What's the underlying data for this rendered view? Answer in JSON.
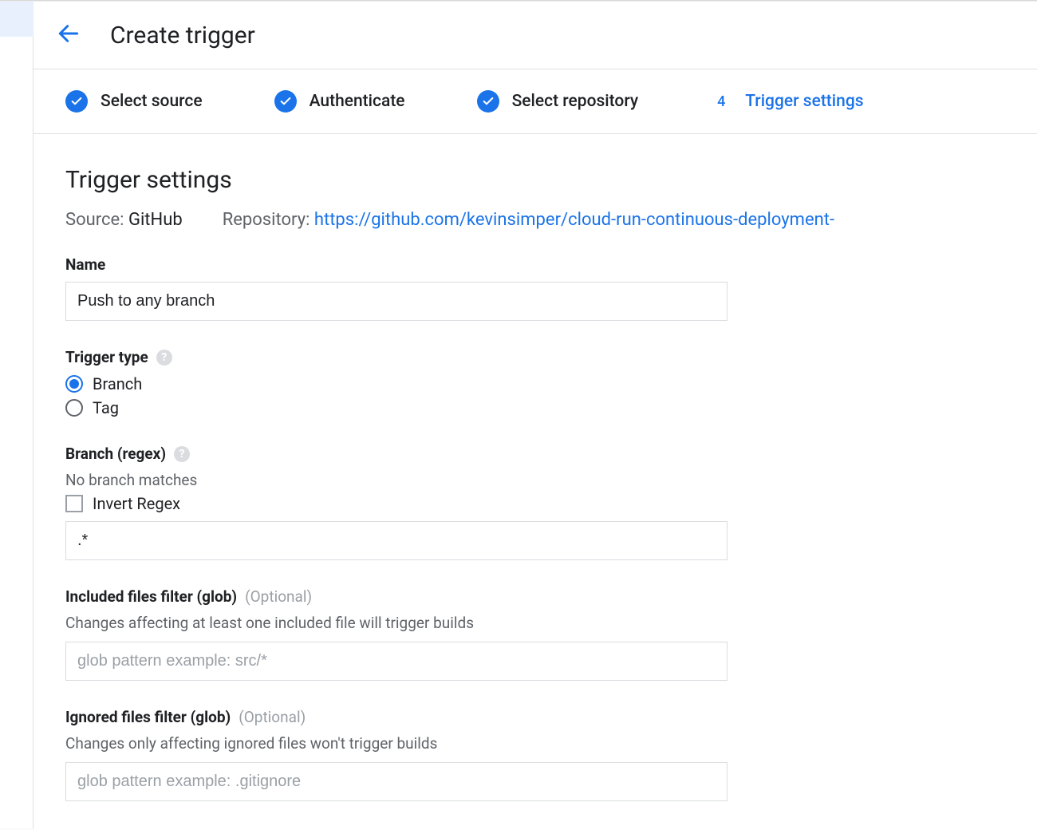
{
  "page_title": "Create trigger",
  "stepper": [
    {
      "label": "Select source",
      "done": true
    },
    {
      "label": "Authenticate",
      "done": true
    },
    {
      "label": "Select repository",
      "done": true
    },
    {
      "number": "4",
      "label": "Trigger settings",
      "current": true
    }
  ],
  "section_title": "Trigger settings",
  "meta": {
    "source_label": "Source:",
    "source_value": "GitHub",
    "repo_label": "Repository:",
    "repo_url": "https://github.com/kevinsimper/cloud-run-continuous-deployment-"
  },
  "name": {
    "label": "Name",
    "value": "Push to any branch"
  },
  "trigger_type": {
    "label": "Trigger type",
    "options": [
      {
        "label": "Branch",
        "checked": true
      },
      {
        "label": "Tag",
        "checked": false
      }
    ]
  },
  "branch_regex": {
    "label": "Branch (regex)",
    "subtext": "No branch matches",
    "invert_label": "Invert Regex",
    "invert_checked": false,
    "value": ".*"
  },
  "included": {
    "label": "Included files filter (glob)",
    "optional": "(Optional)",
    "desc": "Changes affecting at least one included file will trigger builds",
    "placeholder": "glob pattern example: src/*"
  },
  "ignored": {
    "label": "Ignored files filter (glob)",
    "optional": "(Optional)",
    "desc": "Changes only affecting ignored files won't trigger builds",
    "placeholder": "glob pattern example: .gitignore"
  }
}
